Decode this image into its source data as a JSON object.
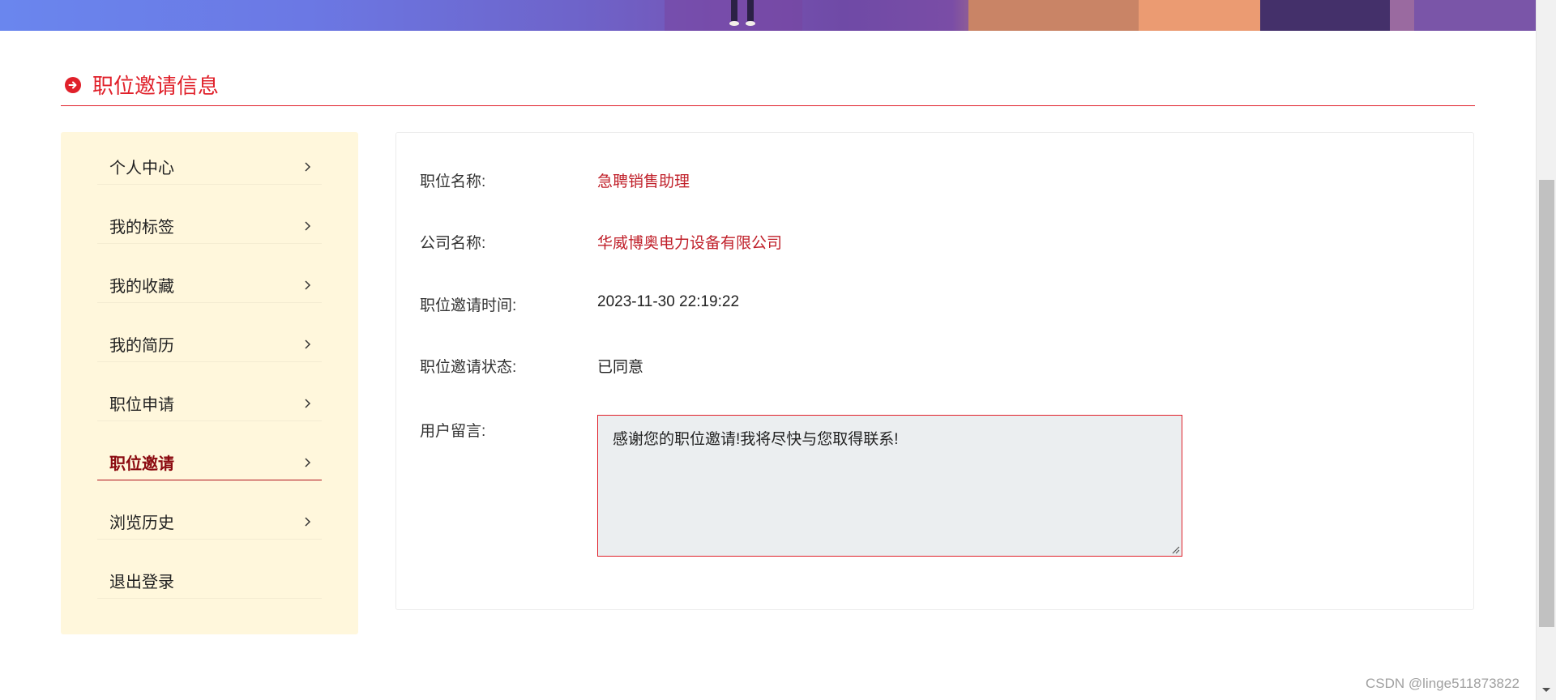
{
  "section": {
    "title": "职位邀请信息",
    "icon": "arrow-right-circle-icon"
  },
  "sidebar": {
    "items": [
      {
        "label": "个人中心",
        "active": false,
        "chevron": true
      },
      {
        "label": "我的标签",
        "active": false,
        "chevron": true
      },
      {
        "label": "我的收藏",
        "active": false,
        "chevron": true
      },
      {
        "label": "我的简历",
        "active": false,
        "chevron": true
      },
      {
        "label": "职位申请",
        "active": false,
        "chevron": true
      },
      {
        "label": "职位邀请",
        "active": true,
        "chevron": true
      },
      {
        "label": "浏览历史",
        "active": false,
        "chevron": true
      },
      {
        "label": "退出登录",
        "active": false,
        "chevron": false
      }
    ]
  },
  "detail": {
    "job_name": {
      "label": "职位名称:",
      "value": "急聘销售助理"
    },
    "company_name": {
      "label": "公司名称:",
      "value": "华威博奥电力设备有限公司"
    },
    "invite_time": {
      "label": "职位邀请时间:",
      "value": "2023-11-30 22:19:22"
    },
    "invite_status": {
      "label": "职位邀请状态:",
      "value": "已同意"
    },
    "user_message": {
      "label": "用户留言:",
      "value": "感谢您的职位邀请!我将尽快与您取得联系!"
    }
  },
  "watermark": "CSDN @linge511873822",
  "colors": {
    "accent": "#e0202a",
    "active_text": "#8b0a10",
    "sidebar_bg": "#fff7dc",
    "message_bg": "#ebeef0"
  }
}
